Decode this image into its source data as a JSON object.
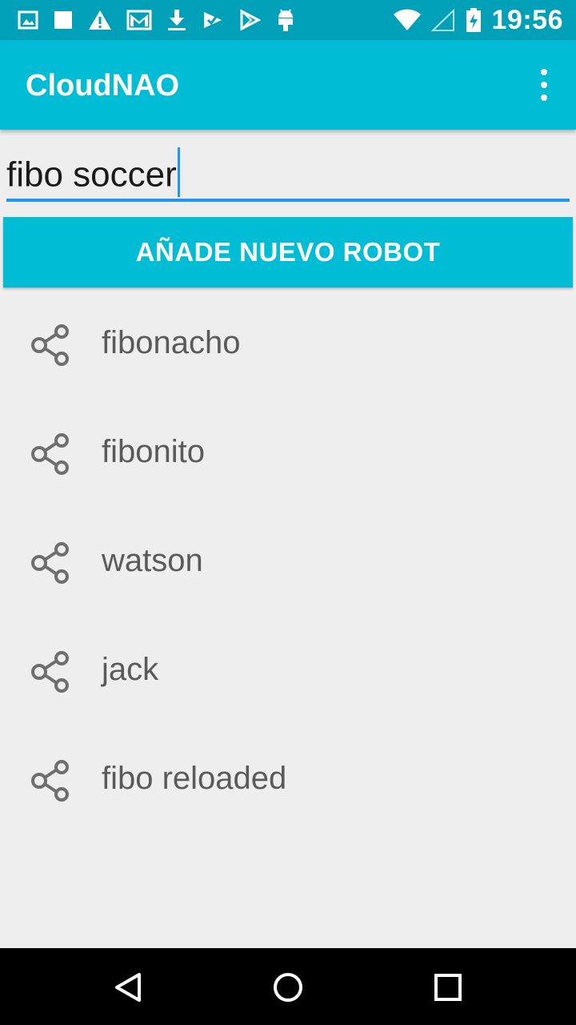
{
  "status_bar": {
    "time": "19:56",
    "left_icons": [
      "image-icon",
      "square-icon",
      "warning-icon",
      "gmail-icon",
      "download-icon",
      "task-icon",
      "play-store-icon",
      "android-icon"
    ],
    "right_icons": [
      "wifi-icon",
      "cell-signal-icon",
      "battery-icon"
    ]
  },
  "app_bar": {
    "title": "CloudNAO",
    "overflow_icon": "more-vert-icon"
  },
  "search": {
    "value": "fibo soccer"
  },
  "add_robot_button": {
    "label": "AÑADE NUEVO ROBOT"
  },
  "robots": [
    {
      "name": "fibonacho",
      "icon": "share-icon"
    },
    {
      "name": "fibonito",
      "icon": "share-icon"
    },
    {
      "name": "watson",
      "icon": "share-icon"
    },
    {
      "name": "jack",
      "icon": "share-icon"
    },
    {
      "name": "fibo reloaded",
      "icon": "share-icon"
    }
  ],
  "nav_bar": {
    "buttons": [
      "back-icon",
      "home-icon",
      "recents-icon"
    ]
  },
  "colors": {
    "status_bar": "#00a0b8",
    "app_bar": "#00bcd4",
    "accent": "#2196f3",
    "background": "#eeeeee",
    "list_text": "#5a5a5a"
  }
}
